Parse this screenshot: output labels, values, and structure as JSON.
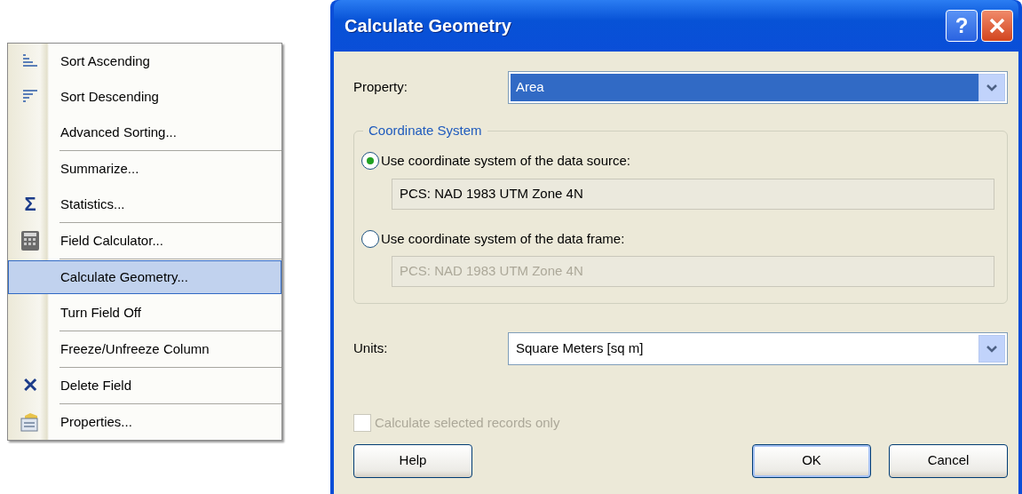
{
  "context_menu": {
    "items": [
      {
        "label": "Sort Ascending",
        "kind": "sort-ascending",
        "separator_before": false,
        "selected": false
      },
      {
        "label": "Sort Descending",
        "kind": "sort-descending",
        "separator_before": false,
        "selected": false
      },
      {
        "label": "Advanced Sorting...",
        "separator_before": false,
        "selected": false
      },
      {
        "label": "Summarize...",
        "separator_before": true,
        "selected": false
      },
      {
        "label": "Statistics...",
        "kind": "glyph",
        "glyph": "Σ",
        "separator_before": false,
        "selected": false
      },
      {
        "label": "Field Calculator...",
        "kind": "calculator",
        "separator_before": true,
        "selected": false
      },
      {
        "label": "Calculate Geometry...",
        "separator_before": true,
        "selected": true
      },
      {
        "label": "Turn Field Off",
        "separator_before": false,
        "selected": false
      },
      {
        "label": "Freeze/Unfreeze Column",
        "separator_before": true,
        "selected": false
      },
      {
        "label": "Delete Field",
        "kind": "glyph",
        "glyph": "✕",
        "separator_before": true,
        "selected": false
      },
      {
        "label": "Properties...",
        "kind": "properties",
        "separator_before": true,
        "selected": false
      }
    ]
  },
  "dialog": {
    "title": "Calculate Geometry",
    "help_button": "?",
    "property": {
      "label": "Property:",
      "value": "Area",
      "focused": true
    },
    "coordinate_system": {
      "legend": "Coordinate System",
      "options": [
        {
          "label": "Use coordinate system of the data source:",
          "selected": true,
          "value": "PCS: NAD 1983 UTM Zone 4N",
          "disabled": false
        },
        {
          "label": "Use coordinate system of the data frame:",
          "selected": false,
          "value": "PCS: NAD 1983 UTM Zone 4N",
          "disabled": true
        }
      ]
    },
    "units": {
      "label": "Units:",
      "value": "Square Meters [sq m]",
      "focused": false
    },
    "selected_only": {
      "label": "Calculate selected records only",
      "checked": false,
      "disabled": true
    },
    "buttons": [
      {
        "label": "Help",
        "default": false
      },
      {
        "label": "OK",
        "default": true
      },
      {
        "label": "Cancel",
        "default": false
      }
    ]
  }
}
